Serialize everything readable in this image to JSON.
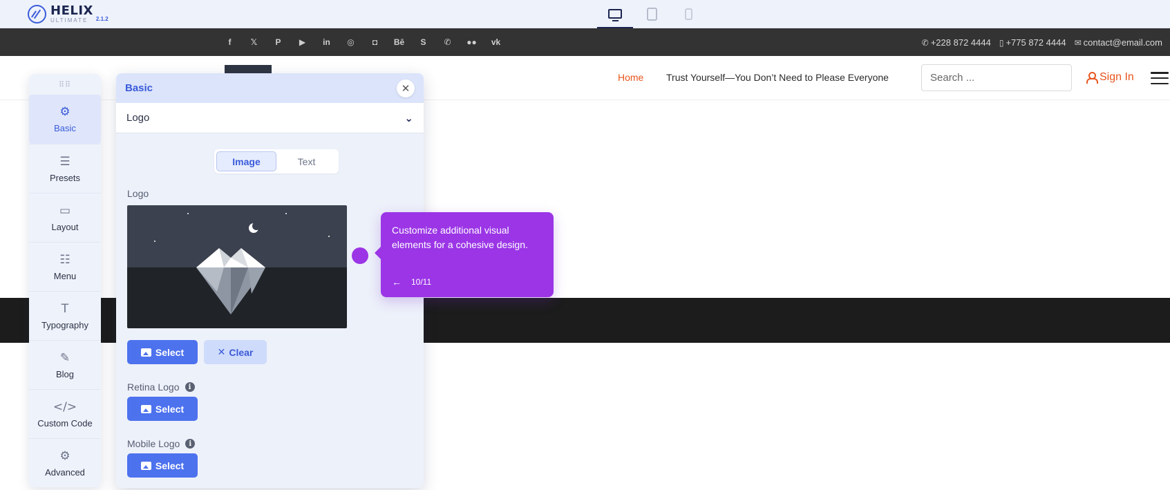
{
  "editor": {
    "brand_name": "HELIX",
    "brand_sub": "ULTIMATE",
    "brand_version": "2.1.2",
    "devices": [
      {
        "icon": "desktop-icon",
        "active": true
      },
      {
        "icon": "tablet-icon",
        "active": false
      },
      {
        "icon": "mobile-icon",
        "active": false
      }
    ]
  },
  "topbar": {
    "social": [
      {
        "icon": "facebook-icon",
        "glyph": "f"
      },
      {
        "icon": "x-icon",
        "glyph": "𝕏"
      },
      {
        "icon": "pinterest-icon",
        "glyph": "P"
      },
      {
        "icon": "youtube-icon",
        "glyph": "▶"
      },
      {
        "icon": "linkedin-icon",
        "glyph": "in"
      },
      {
        "icon": "dribbble-icon",
        "glyph": "◎"
      },
      {
        "icon": "instagram-icon",
        "glyph": "◘"
      },
      {
        "icon": "behance-icon",
        "glyph": "Bē"
      },
      {
        "icon": "skype-icon",
        "glyph": "S"
      },
      {
        "icon": "whatsapp-icon",
        "glyph": "✆"
      },
      {
        "icon": "flickr-icon",
        "glyph": "●●"
      },
      {
        "icon": "vk-icon",
        "glyph": "vk"
      }
    ],
    "phone": "+228 872 4444",
    "mobile": "+775 872 4444",
    "email": "contact@email.com"
  },
  "header": {
    "nav_home": "Home",
    "nav_article": "Trust Yourself—You Don’t Need to Please Everyone",
    "search_placeholder": "Search ...",
    "signin": "Sign In"
  },
  "dock": {
    "items": [
      {
        "label": "Basic",
        "icon": "gear-icon",
        "glyph": "⚙",
        "active": true
      },
      {
        "label": "Presets",
        "icon": "sliders-icon",
        "glyph": "☰",
        "active": false
      },
      {
        "label": "Layout",
        "icon": "layout-icon",
        "glyph": "▭",
        "active": false
      },
      {
        "label": "Menu",
        "icon": "menu-list-icon",
        "glyph": "☷",
        "active": false
      },
      {
        "label": "Typography",
        "icon": "typography-icon",
        "glyph": "T",
        "active": false
      },
      {
        "label": "Blog",
        "icon": "blog-icon",
        "glyph": "✎",
        "active": false
      },
      {
        "label": "Custom Code",
        "icon": "code-icon",
        "glyph": "</>",
        "active": false
      },
      {
        "label": "Advanced",
        "icon": "advanced-icon",
        "glyph": "⚙",
        "active": false
      }
    ]
  },
  "panel": {
    "title": "Basic",
    "section": "Logo",
    "tab_image": "Image",
    "tab_text": "Text",
    "logo_label": "Logo",
    "select_label": "Select",
    "clear_label": "Clear",
    "retina_label": "Retina Logo",
    "mobile_label": "Mobile Logo"
  },
  "tour": {
    "text": "Customize additional visual elements for a cohesive design.",
    "step": "10/11",
    "color": "#9b35e6"
  }
}
